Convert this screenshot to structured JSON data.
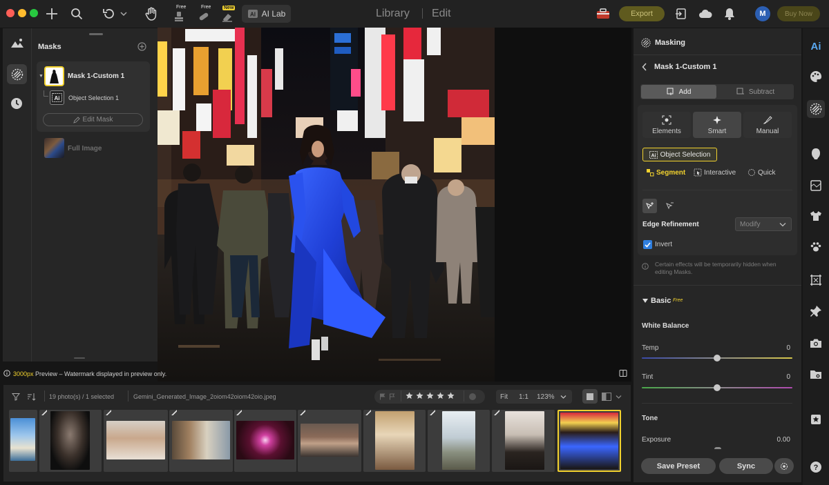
{
  "titlebar": {
    "free_badge_1": "Free",
    "free_badge_2": "Free",
    "new_badge": "New",
    "ai_lab": "AI Lab",
    "mode_library": "Library",
    "mode_edit": "Edit",
    "export": "Export",
    "avatar_initial": "M",
    "buy_now": "Buy Now"
  },
  "masks_panel": {
    "title": "Masks",
    "mask_name": "Mask 1-Custom 1",
    "object_selection": "Object Selection 1",
    "edit_mask": "Edit Mask",
    "full_image": "Full Image"
  },
  "canvas": {
    "preview_size": "3000px",
    "preview_note": " Preview – Watermark displayed in preview only."
  },
  "filmstrip": {
    "count": "19 photo(s) / 1 selected",
    "filename": "Gemini_Generated_Image_2oiom42oiom42oio.jpeg",
    "rating_stars": 5,
    "fit": "Fit",
    "one_to_one": "1:1",
    "zoom": "123%"
  },
  "masking": {
    "title": "Masking",
    "mask_name": "Mask 1-Custom 1",
    "add": "Add",
    "subtract": "Subtract",
    "elements": "Elements",
    "smart": "Smart",
    "manual": "Manual",
    "object_selection": "Object Selection",
    "segment": "Segment",
    "interactive": "Interactive",
    "quick": "Quick",
    "edge_refinement": "Edge Refinement",
    "modify": "Modify",
    "invert": "Invert",
    "note": "Certain effects will be temporarily hidden when editing Masks."
  },
  "basic": {
    "title": "Basic",
    "free_badge": "Free",
    "white_balance": "White Balance",
    "temp_label": "Temp",
    "temp_value": "0",
    "tint_label": "Tint",
    "tint_value": "0",
    "tone": "Tone",
    "exposure_label": "Exposure",
    "exposure_value": "0.00"
  },
  "footer": {
    "save_preset": "Save Preset",
    "sync": "Sync"
  },
  "colors": {
    "accent_yellow": "#f2d22e",
    "export_bg": "#5f5a1e",
    "checkbox_blue": "#2f7fe0"
  }
}
